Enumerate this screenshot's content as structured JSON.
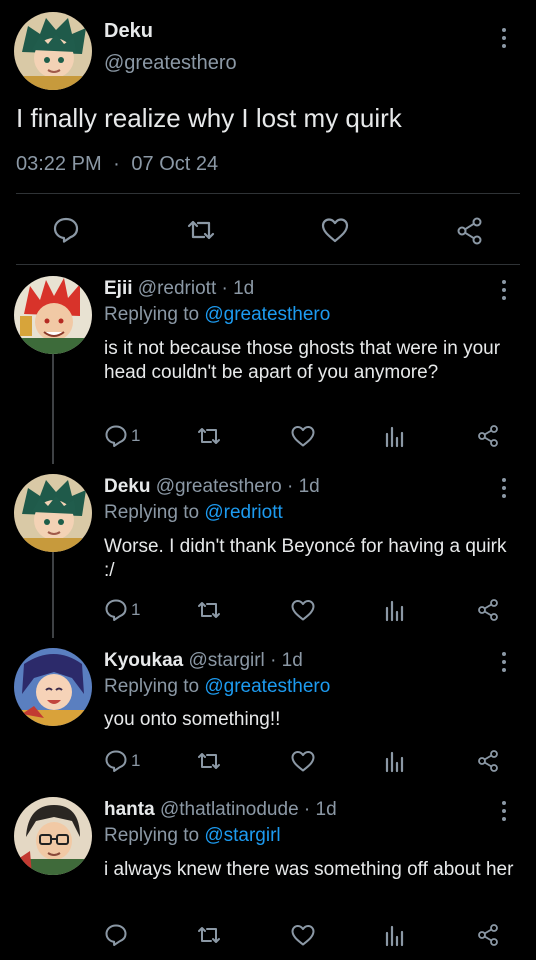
{
  "main_tweet": {
    "name": "Deku",
    "handle": "@greatesthero",
    "text": "I finally realize why I lost my quirk",
    "time": "03:22 PM",
    "separator": "·",
    "date": "07 Oct 24"
  },
  "replies": [
    {
      "name": "Ejii",
      "handle": "@redriott",
      "time": "1d",
      "replying_label": "Replying to",
      "replying_to": "@greatesthero",
      "text": "is it not because those ghosts that were in your head couldn't be apart of you anymore?",
      "reply_count": "1"
    },
    {
      "name": "Deku",
      "handle": "@greatesthero",
      "time": "1d",
      "replying_label": "Replying to",
      "replying_to": "@redriott",
      "text": "Worse. I didn't thank Beyoncé for having a quirk :/",
      "reply_count": "1"
    },
    {
      "name": "Kyoukaa",
      "handle": "@stargirl",
      "time": "1d",
      "replying_label": "Replying to",
      "replying_to": "@greatesthero",
      "text": "you onto something!!",
      "reply_count": "1"
    },
    {
      "name": "hanta",
      "handle": "@thatlatinodude",
      "time": "1d",
      "replying_label": "Replying to",
      "replying_to": "@stargirl",
      "text": "i always knew there was something off about her",
      "reply_count": ""
    }
  ],
  "icons": {
    "reply": "reply-icon",
    "retweet": "retweet-icon",
    "like": "heart-icon",
    "stats": "stats-icon",
    "share": "share-icon",
    "more": "more-dots-icon"
  },
  "colors": {
    "background": "#000000",
    "text": "#e7e9ea",
    "secondary": "#8b98a5",
    "mention": "#1d9bf0"
  }
}
